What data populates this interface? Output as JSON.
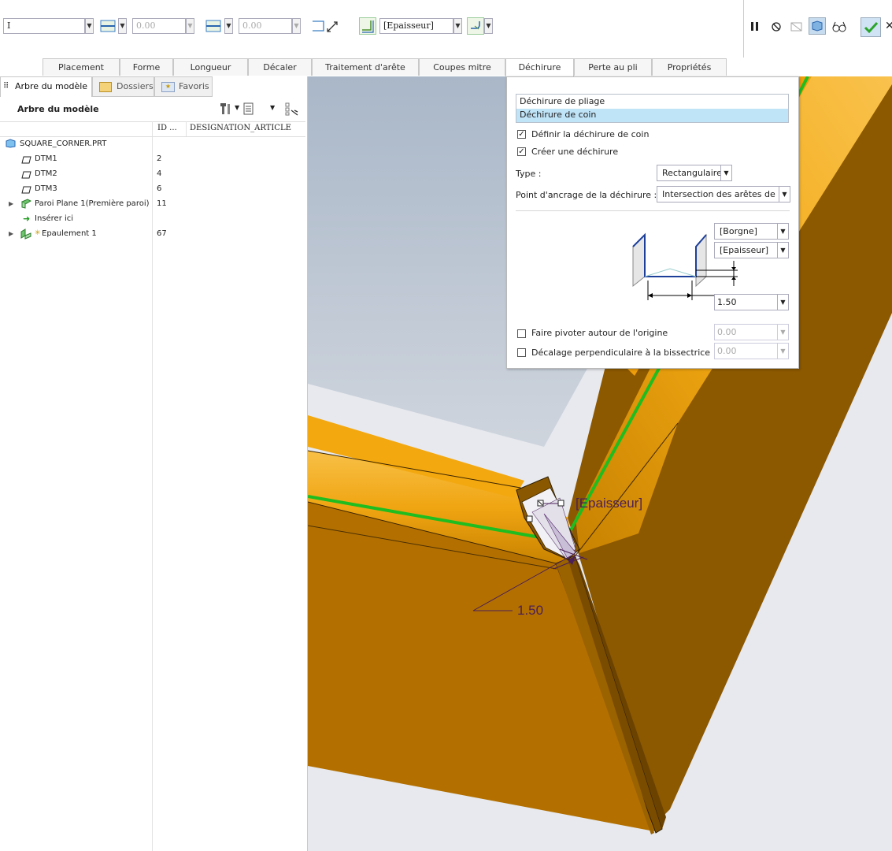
{
  "toolbar": {
    "field1_value": "I",
    "offset1_value": "0.00",
    "offset2_value": "0.00",
    "thickness_value": "[Epaisseur]"
  },
  "tabs": [
    {
      "label": "Placement"
    },
    {
      "label": "Forme"
    },
    {
      "label": "Longueur"
    },
    {
      "label": "Décaler"
    },
    {
      "label": "Traitement d'arête"
    },
    {
      "label": "Coupes mitre"
    },
    {
      "label": "Déchirure"
    },
    {
      "label": "Perte au pli"
    },
    {
      "label": "Propriétés"
    }
  ],
  "left_panel": {
    "tabs": [
      {
        "label": "Arbre du modèle"
      },
      {
        "label": "Dossiers"
      },
      {
        "label": "Favoris"
      }
    ],
    "title": "Arbre du modèle",
    "columns": {
      "id": "ID ...",
      "designation": "DESIGNATION_ARTICLE"
    },
    "rows": [
      {
        "label": "SQUARE_CORNER.PRT",
        "id": ""
      },
      {
        "label": "DTM1",
        "id": "2"
      },
      {
        "label": "DTM2",
        "id": "4"
      },
      {
        "label": "DTM3",
        "id": "6"
      },
      {
        "label": "Paroi Plane 1(Première paroi)",
        "id": "11"
      },
      {
        "label": "Insérer ici",
        "id": ""
      },
      {
        "label": "Epaulement 1",
        "id": "67"
      }
    ]
  },
  "popup": {
    "list": [
      "Déchirure de pliage",
      "Déchirure de coin"
    ],
    "define_corner_relief": "Définir la déchirure de coin",
    "create_relief": "Créer une déchirure",
    "type_label": "Type :",
    "type_value": "Rectangulaire",
    "anchor_label": "Point d'ancrage de la déchirure :",
    "anchor_value": "Intersection des arêtes de pli",
    "depth_value": "[Borgne]",
    "width_value": "[Epaisseur]",
    "dim_value": "1.50",
    "rotate_label": "Faire pivoter autour de l'origine",
    "rotate_value": "0.00",
    "offset_label": "Décalage perpendiculaire à la bissectrice",
    "offset_value": "0.00"
  },
  "viewport": {
    "thickness_annotation": "[Epaisseur]",
    "dimension_annotation": "1.50"
  },
  "colors": {
    "model_orange": "#b67200",
    "model_dark": "#8c5800",
    "model_light": "#f3a80f",
    "edge_green": "#1fbd1f",
    "selection_blue": "#bfe3f7"
  }
}
